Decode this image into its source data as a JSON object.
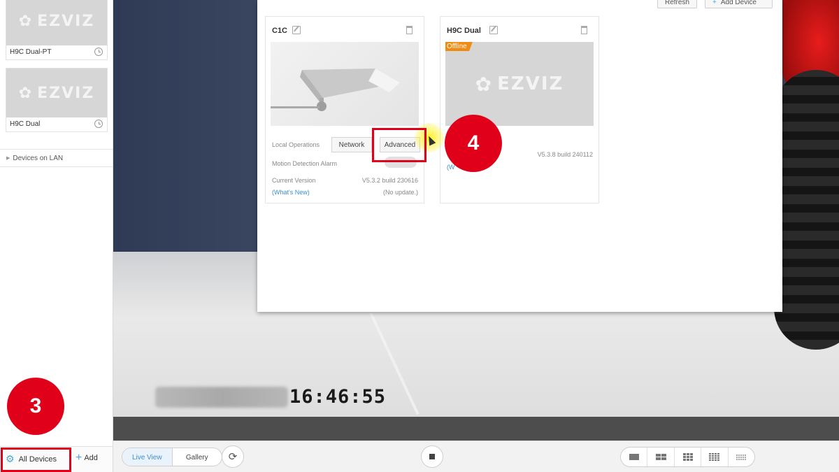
{
  "sidebar": {
    "cameras": [
      {
        "name": "H9C Dual-PT",
        "logo": "EZVIZ"
      },
      {
        "name": "H9C Dual",
        "logo": "EZVIZ"
      }
    ],
    "lan_section": "Devices on LAN",
    "footer": {
      "all_devices": "All Devices",
      "add": "Add"
    }
  },
  "panel": {
    "buttons": {
      "refresh": "Refresh",
      "add_device": "Add Device"
    },
    "devices": [
      {
        "name": "C1C",
        "local_operations_label": "Local Operations",
        "network_button": "Network",
        "advanced_button": "Advanced",
        "motion_label": "Motion Detection Alarm",
        "current_version_label": "Current Version",
        "version": "V5.3.2 build 230616",
        "whats_new": "(What's New)",
        "update_status": "(No update.)"
      },
      {
        "name": "H9C Dual",
        "status_badge": "Offline",
        "logo": "EZVIZ",
        "version": "V5.3.8 build 240112",
        "link_fragment": "(W"
      }
    ]
  },
  "video": {
    "timestamp": "16:46:55"
  },
  "toolbar": {
    "live_view": "Live View",
    "gallery": "Gallery"
  },
  "annotations": {
    "step3": "3",
    "step4": "4"
  },
  "colors": {
    "accent": "#4aa3df",
    "annotation": "#e0001a",
    "offline": "#f08a10"
  }
}
